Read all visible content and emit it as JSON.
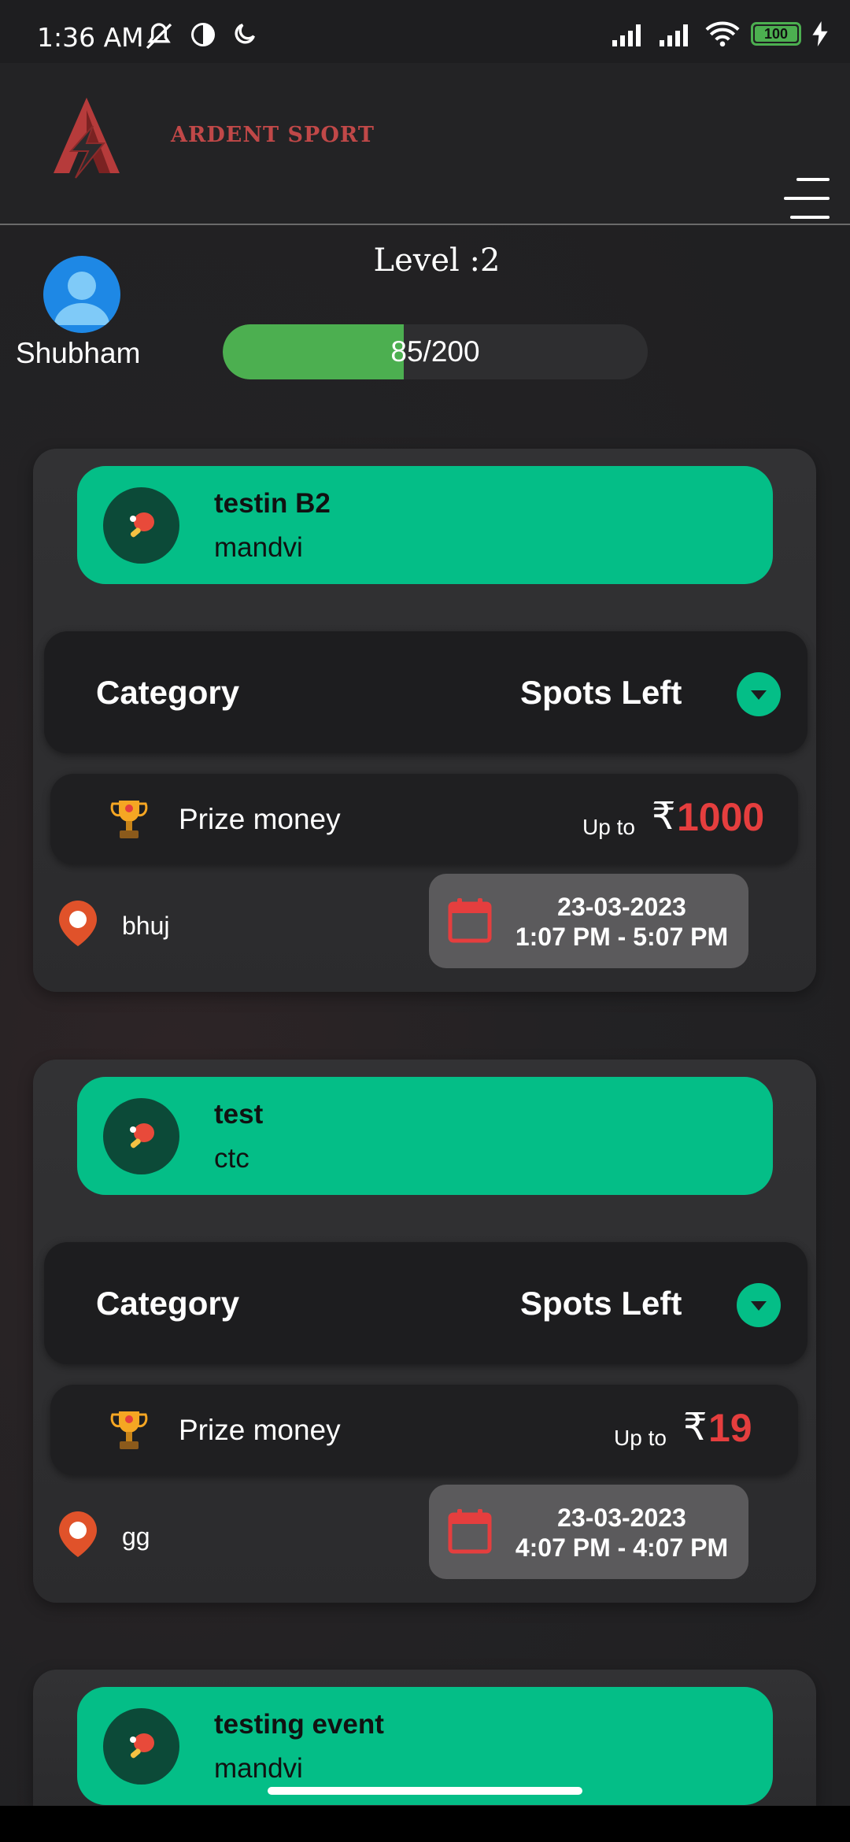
{
  "status_bar": {
    "time": "1:36 AM",
    "battery": "100",
    "icons": [
      "mute-icon",
      "data-saver-icon",
      "moon-icon",
      "signal-icon",
      "signal-icon",
      "wifi-icon",
      "battery-icon",
      "charging-icon"
    ]
  },
  "header": {
    "brand": "ARDENT SPORT",
    "menu_icon": "hamburger-menu-icon"
  },
  "profile": {
    "name": "Shubham",
    "level": "Level :2",
    "progress_label": "85/200",
    "progress_value": 85,
    "progress_max": 200
  },
  "colors": {
    "accent_green": "#04be87",
    "progress_green": "#4caf50",
    "prize_red": "#e53e3e"
  },
  "events": [
    {
      "title": "testin B2",
      "subtitle": "mandvi",
      "category_label": "Category",
      "spots_label": "Spots Left",
      "prize_label": "Prize money",
      "upto": "Up to",
      "currency": "₹",
      "amount": "1000",
      "location": "bhuj",
      "date": "23-03-2023",
      "time": "1:07 PM - 5:07 PM"
    },
    {
      "title": "test",
      "subtitle": "ctc",
      "category_label": "Category",
      "spots_label": "Spots Left",
      "prize_label": "Prize money",
      "upto": "Up to",
      "currency": "₹",
      "amount": "19",
      "location": "gg",
      "date": "23-03-2023",
      "time": "4:07 PM - 4:07 PM"
    },
    {
      "title": "testing event",
      "subtitle": "mandvi"
    }
  ]
}
